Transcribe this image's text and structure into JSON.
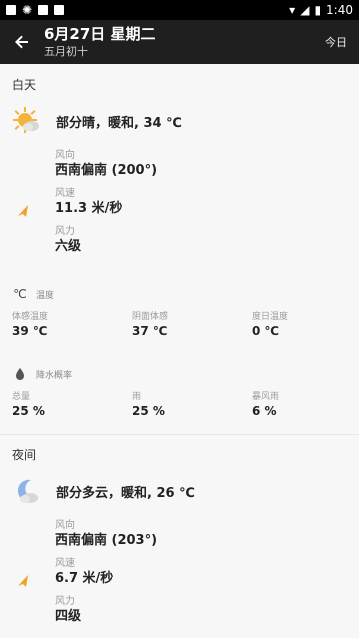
{
  "status_bar": {
    "time": "1:40"
  },
  "app_bar": {
    "title": "6月27日 星期二",
    "subtitle": "五月初十",
    "action_today": "今日"
  },
  "day": {
    "section_title": "白天",
    "summary": "部分晴，暖和, 34 ℃",
    "wind_direction_label": "风向",
    "wind_direction_value": "西南偏南 (200°)",
    "wind_speed_label": "风速",
    "wind_speed_value": "11.3 米/秒",
    "wind_force_label": "风力",
    "wind_force_value": "六级"
  },
  "temperature": {
    "icon_text": "℃",
    "label": "温度",
    "items": [
      {
        "label": "体感温度",
        "value": "39 ℃"
      },
      {
        "label": "阴面体感",
        "value": "37 ℃"
      },
      {
        "label": "度日温度",
        "value": "0 ℃"
      }
    ]
  },
  "precip": {
    "label": "降水概率",
    "items": [
      {
        "label": "总量",
        "value": "25 %"
      },
      {
        "label": "雨",
        "value": "25 %"
      },
      {
        "label": "暴风雨",
        "value": "6 %"
      }
    ]
  },
  "night": {
    "section_title": "夜间",
    "summary": "部分多云，暖和, 26 ℃",
    "wind_direction_label": "风向",
    "wind_direction_value": "西南偏南 (203°)",
    "wind_speed_label": "风速",
    "wind_speed_value": "6.7 米/秒",
    "wind_force_label": "风力",
    "wind_force_value": "四级"
  },
  "colors": {
    "appbar": "#1f1f1f",
    "sun": "#f4b43a",
    "arrow": "#f0a22a",
    "moon": "#8fb3e6"
  },
  "icons": {
    "back": "arrow-left-icon",
    "day_weather": "sun-cloud-icon",
    "night_weather": "moon-icon",
    "wind": "wind-arrow-icon",
    "drop": "drop-icon"
  }
}
